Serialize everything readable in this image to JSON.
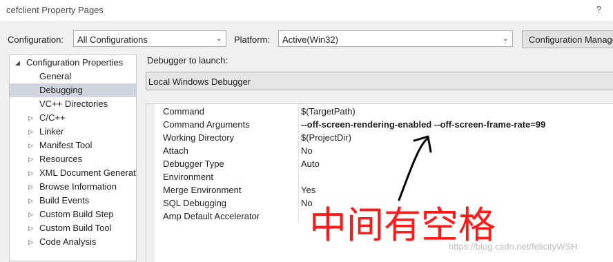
{
  "window": {
    "title": "cefclient Property Pages",
    "help_glyph": "?"
  },
  "configuration": {
    "label": "Configuration:",
    "value": "All Configurations"
  },
  "platform": {
    "label": "Platform:",
    "value": "Active(Win32)"
  },
  "config_manager_label": "Configuration Manager...",
  "tree": [
    {
      "label": "Configuration Properties",
      "expanded": true
    },
    {
      "label": "General"
    },
    {
      "label": "Debugging",
      "selected": true
    },
    {
      "label": "VC++ Directories"
    },
    {
      "label": "C/C++",
      "expandable": true
    },
    {
      "label": "Linker",
      "expandable": true
    },
    {
      "label": "Manifest Tool",
      "expandable": true
    },
    {
      "label": "Resources",
      "expandable": true
    },
    {
      "label": "XML Document Generator",
      "expandable": true
    },
    {
      "label": "Browse Information",
      "expandable": true
    },
    {
      "label": "Build Events",
      "expandable": true
    },
    {
      "label": "Custom Build Step",
      "expandable": true
    },
    {
      "label": "Custom Build Tool",
      "expandable": true
    },
    {
      "label": "Code Analysis",
      "expandable": true
    }
  ],
  "debugger": {
    "label": "Debugger to launch:",
    "value": "Local Windows Debugger"
  },
  "properties": [
    {
      "name": "Command",
      "value": "$(TargetPath)"
    },
    {
      "name": "Command Arguments",
      "value": "--off-screen-rendering-enabled --off-screen-frame-rate=99",
      "bold": true
    },
    {
      "name": "Working Directory",
      "value": "$(ProjectDir)"
    },
    {
      "name": "Attach",
      "value": "No"
    },
    {
      "name": "Debugger Type",
      "value": "Auto"
    },
    {
      "name": "Environment",
      "value": ""
    },
    {
      "name": "Merge Environment",
      "value": "Yes"
    },
    {
      "name": "SQL Debugging",
      "value": "No"
    },
    {
      "name": "Amp Default Accelerator",
      "value": ""
    }
  ],
  "annotation": {
    "text": "中间有空格",
    "color": "#ff1a1a"
  },
  "watermark": "https://blog.csdn.net/felicityWSH",
  "icons": {
    "expanded": "triangle-down-icon",
    "collapsed": "triangle-right-icon",
    "dropdown": "chevron-down-icon"
  }
}
